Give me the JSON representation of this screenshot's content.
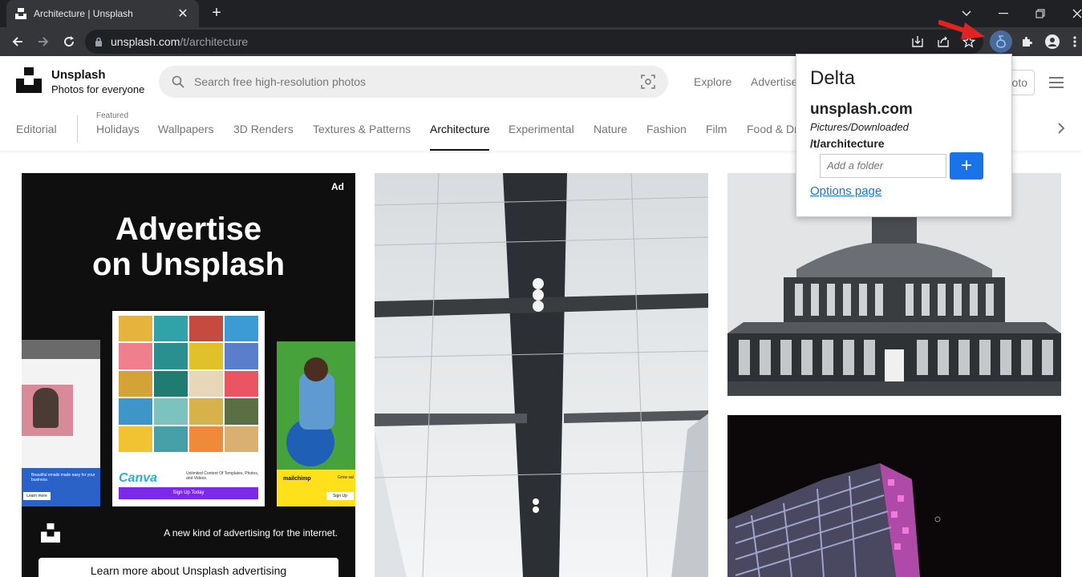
{
  "browser": {
    "tab_title": "Architecture | Unsplash",
    "tab_close": "✕",
    "new_tab": "+",
    "url_host": "unsplash.com",
    "url_path": "/t/architecture"
  },
  "header": {
    "brand_name": "Unsplash",
    "brand_tagline": "Photos for everyone",
    "search_placeholder": "Search free high-resolution photos",
    "explore": "Explore",
    "advertise": "Advertise",
    "submit_partial": "oto"
  },
  "topics": {
    "editorial": "Editorial",
    "featured_label": "Featured",
    "items": [
      "Holidays",
      "Wallpapers",
      "3D Renders",
      "Textures & Patterns",
      "Architecture",
      "Experimental",
      "Nature",
      "Fashion",
      "Film",
      "Food & Dr"
    ],
    "active": "Architecture"
  },
  "ad": {
    "label": "Ad",
    "headline_1": "Advertise",
    "headline_2": "on Unsplash",
    "tagline": "A new kind of advertising for the internet.",
    "cta": "Learn more about Unsplash advertising",
    "canva": "Canva",
    "canva_sub": "Unlimited Content Of Templates, Photos, and Videos.",
    "canva_btn": "Sign Up Today",
    "mailchimp": "mailchimp",
    "mailchimp_sub": "Grow sal",
    "mailchimp_btn": "Sign Up",
    "left_card_text": "Beautiful emails made easy for your business.",
    "left_card_btn": "Learn more"
  },
  "popup": {
    "title": "Delta",
    "domain": "unsplash.com",
    "path": "Pictures/Downloaded",
    "subpath": "/t/architecture",
    "folder_placeholder": "Add a folder",
    "add_symbol": "+",
    "options_link": "Options page"
  },
  "colors": {
    "chrome_dark": "#202124",
    "chrome_toolbar": "#35363a",
    "accent_blue": "#1a73e8",
    "annotation_arrow": "#e52222"
  }
}
